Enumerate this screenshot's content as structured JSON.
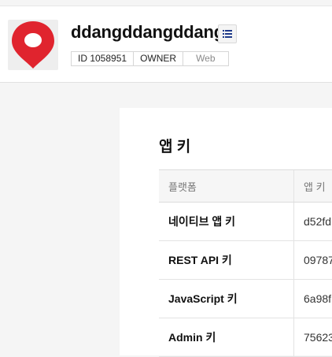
{
  "app": {
    "name": "ddangddangddang",
    "icon": "map-pin-icon",
    "chips": [
      "ID 1058951",
      "OWNER",
      "Web"
    ]
  },
  "menu_button": {
    "icon": "list-icon"
  },
  "section": {
    "title": "앱 키",
    "columns": [
      "플랫폼",
      "앱 키"
    ],
    "rows": [
      {
        "platform": "네이티브 앱 키",
        "key": "d52fd"
      },
      {
        "platform": "REST API 키",
        "key": "09787"
      },
      {
        "platform": "JavaScript 키",
        "key": "6a98f"
      },
      {
        "platform": "Admin 키",
        "key": "75623"
      }
    ]
  },
  "colors": {
    "pin_red": "#e0242e",
    "menu_icon": "#1f3a8a"
  }
}
